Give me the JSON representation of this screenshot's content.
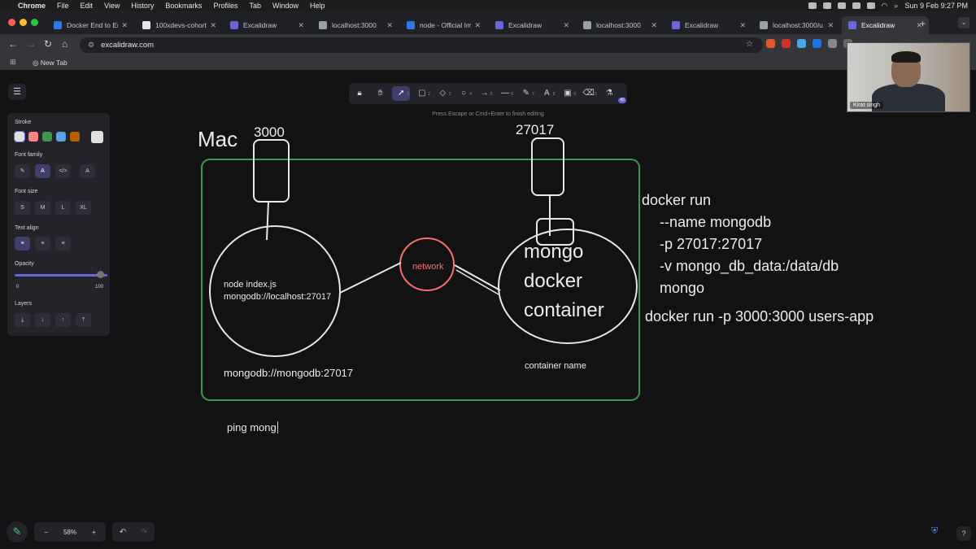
{
  "menubar": {
    "app": "Chrome",
    "items": [
      "File",
      "Edit",
      "View",
      "History",
      "Bookmarks",
      "Profiles",
      "Tab",
      "Window",
      "Help"
    ],
    "datetime": "Sun 9 Feb  9:27 PM"
  },
  "tabs": [
    {
      "title": "Docker End to En",
      "favicon_color": "#2c7be5"
    },
    {
      "title": "100xdevs-cohort",
      "favicon_color": "#e6e6e6"
    },
    {
      "title": "Excalidraw",
      "favicon_color": "#6965db"
    },
    {
      "title": "localhost:3000",
      "favicon_color": "#9aa0a6"
    },
    {
      "title": "node - Official Im",
      "favicon_color": "#2c7be5"
    },
    {
      "title": "Excalidraw",
      "favicon_color": "#6965db"
    },
    {
      "title": "localhost:3000",
      "favicon_color": "#9aa0a6"
    },
    {
      "title": "Excalidraw",
      "favicon_color": "#6965db"
    },
    {
      "title": "localhost:3000/u",
      "favicon_color": "#9aa0a6"
    },
    {
      "title": "Excalidraw",
      "favicon_color": "#6965db",
      "active": true
    }
  ],
  "address": {
    "url": "excalidraw.com"
  },
  "bookmarks": {
    "new_tab": "New Tab"
  },
  "toolbar": {
    "hint": "Press Escape or Cmd+Enter to finish editing",
    "tools": [
      {
        "icon": "lock-icon",
        "glyph": "🔒︎",
        "key": ""
      },
      {
        "icon": "hand-icon",
        "glyph": "✋︎",
        "key": ""
      },
      {
        "icon": "selection-icon",
        "glyph": "➚",
        "key": "1",
        "selected": true
      },
      {
        "icon": "rectangle-icon",
        "glyph": "▢",
        "key": "2"
      },
      {
        "icon": "diamond-icon",
        "glyph": "◇",
        "key": "3"
      },
      {
        "icon": "ellipse-icon",
        "glyph": "○",
        "key": "4"
      },
      {
        "icon": "arrow-icon",
        "glyph": "→",
        "key": "5"
      },
      {
        "icon": "line-icon",
        "glyph": "—",
        "key": "6"
      },
      {
        "icon": "draw-icon",
        "glyph": "✎",
        "key": "7"
      },
      {
        "icon": "text-icon",
        "glyph": "A",
        "key": "8"
      },
      {
        "icon": "image-icon",
        "glyph": "▣",
        "key": "9"
      },
      {
        "icon": "eraser-icon",
        "glyph": "⌫",
        "key": "0"
      },
      {
        "icon": "library-icon",
        "glyph": "⚗",
        "key": ""
      }
    ],
    "library_badge": "42"
  },
  "properties": {
    "stroke_label": "Stroke",
    "stroke_colors": [
      "#e0e0e0",
      "#ff8383",
      "#3a994c",
      "#56a2e8",
      "#b76100",
      "#e0e0e0"
    ],
    "font_family_label": "Font family",
    "font_size_label": "Font size",
    "font_sizes": [
      "S",
      "M",
      "L",
      "XL"
    ],
    "text_align_label": "Text align",
    "opacity_label": "Opacity",
    "opacity_min": "0",
    "opacity_max": "100",
    "opacity_value": 100,
    "layers_label": "Layers"
  },
  "footer": {
    "zoom": "58%",
    "minus": "−",
    "plus": "+"
  },
  "webcam": {
    "name": "Kirat singh"
  },
  "drawing": {
    "mac_label": "Mac",
    "port_left": "3000",
    "port_right": "27017",
    "node_line1": "node index.js",
    "node_line2": "mongodb://localhost:27017",
    "network": "network",
    "mongo_line1": "mongo",
    "mongo_line2": "docker",
    "mongo_line3": "container",
    "mongodb_url": "mongodb://mongodb:27017",
    "container_name": "container name",
    "ping": "ping mong",
    "cmd1_line1": "docker run",
    "cmd1_line2": "--name mongodb",
    "cmd1_line3": "-p 27017:27017",
    "cmd1_line4": "-v mongo_db_data:/data/db",
    "cmd1_line5": "mongo",
    "cmd2": "docker run -p 3000:3000 users-app"
  }
}
